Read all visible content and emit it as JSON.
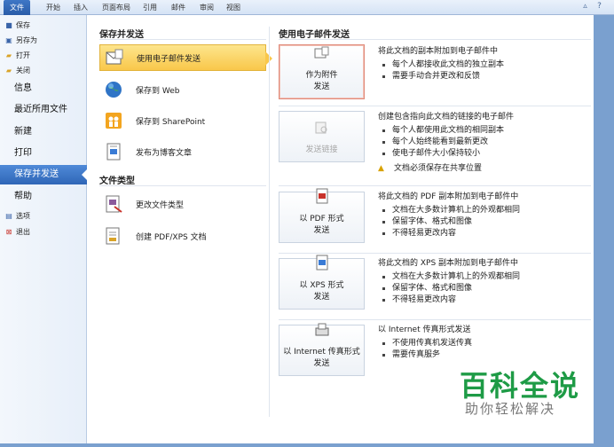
{
  "ribbon": {
    "tabs": [
      "文件",
      "开始",
      "插入",
      "页面布局",
      "引用",
      "邮件",
      "审阅",
      "视图"
    ],
    "active_tab": "文件"
  },
  "left": {
    "small_top": [
      {
        "label": "保存",
        "icon": "save-icon"
      },
      {
        "label": "另存为",
        "icon": "save-as-icon"
      },
      {
        "label": "打开",
        "icon": "open-folder-icon"
      },
      {
        "label": "关闭",
        "icon": "close-file-icon"
      }
    ],
    "big": [
      "信息",
      "最近所用文件",
      "新建",
      "打印",
      "保存并发送",
      "帮助"
    ],
    "selected": "保存并发送",
    "small_bottom": [
      {
        "label": "选项",
        "icon": "options-icon"
      },
      {
        "label": "退出",
        "icon": "exit-icon"
      }
    ]
  },
  "middle": {
    "section1": "保存并发送",
    "items1": [
      {
        "label": "使用电子邮件发送",
        "icon": "email-send-icon"
      },
      {
        "label": "保存到 Web",
        "icon": "globe-icon"
      },
      {
        "label": "保存到 SharePoint",
        "icon": "sharepoint-icon"
      },
      {
        "label": "发布为博客文章",
        "icon": "blog-icon"
      }
    ],
    "section2": "文件类型",
    "items2": [
      {
        "label": "更改文件类型",
        "icon": "change-file-type-icon"
      },
      {
        "label": "创建 PDF/XPS 文档",
        "icon": "pdf-xps-document-icon"
      }
    ]
  },
  "right": {
    "section": "使用电子邮件发送",
    "options": [
      {
        "button_line1": "作为附件",
        "button_line2": "发送",
        "title": "将此文档的副本附加到电子邮件中",
        "bullets": [
          "每个人都接收此文档的独立副本",
          "需要手动合并更改和反馈"
        ],
        "warning": ""
      },
      {
        "button_line1": "发送链接",
        "button_line2": "",
        "title": "创建包含指向此文档的链接的电子邮件",
        "bullets": [
          "每个人都使用此文档的相同副本",
          "每个人始终能看到最新更改",
          "使电子邮件大小保持较小"
        ],
        "warning": "文档必须保存在共享位置"
      },
      {
        "button_line1": "以 PDF 形式",
        "button_line2": "发送",
        "title": "将此文档的 PDF 副本附加到电子邮件中",
        "bullets": [
          "文档在大多数计算机上的外观都相同",
          "保留字体、格式和图像",
          "不得轻易更改内容"
        ],
        "warning": ""
      },
      {
        "button_line1": "以 XPS 形式",
        "button_line2": "发送",
        "title": "将此文档的 XPS 副本附加到电子邮件中",
        "bullets": [
          "文档在大多数计算机上的外观都相同",
          "保留字体、格式和图像",
          "不得轻易更改内容"
        ],
        "warning": ""
      },
      {
        "button_line1": "以 Internet 传真形式",
        "button_line2": "发送",
        "title": "以 Internet 传真形式发送",
        "bullets": [
          "不使用传真机发送传真",
          "需要传真服务"
        ],
        "warning": ""
      }
    ]
  },
  "watermark": {
    "line1": "百科全说",
    "line2": "助你轻松解决"
  },
  "colors": {
    "accent": "#2f66b7",
    "selected_item": "#f9c74a",
    "watermark": "#1e9b46"
  }
}
